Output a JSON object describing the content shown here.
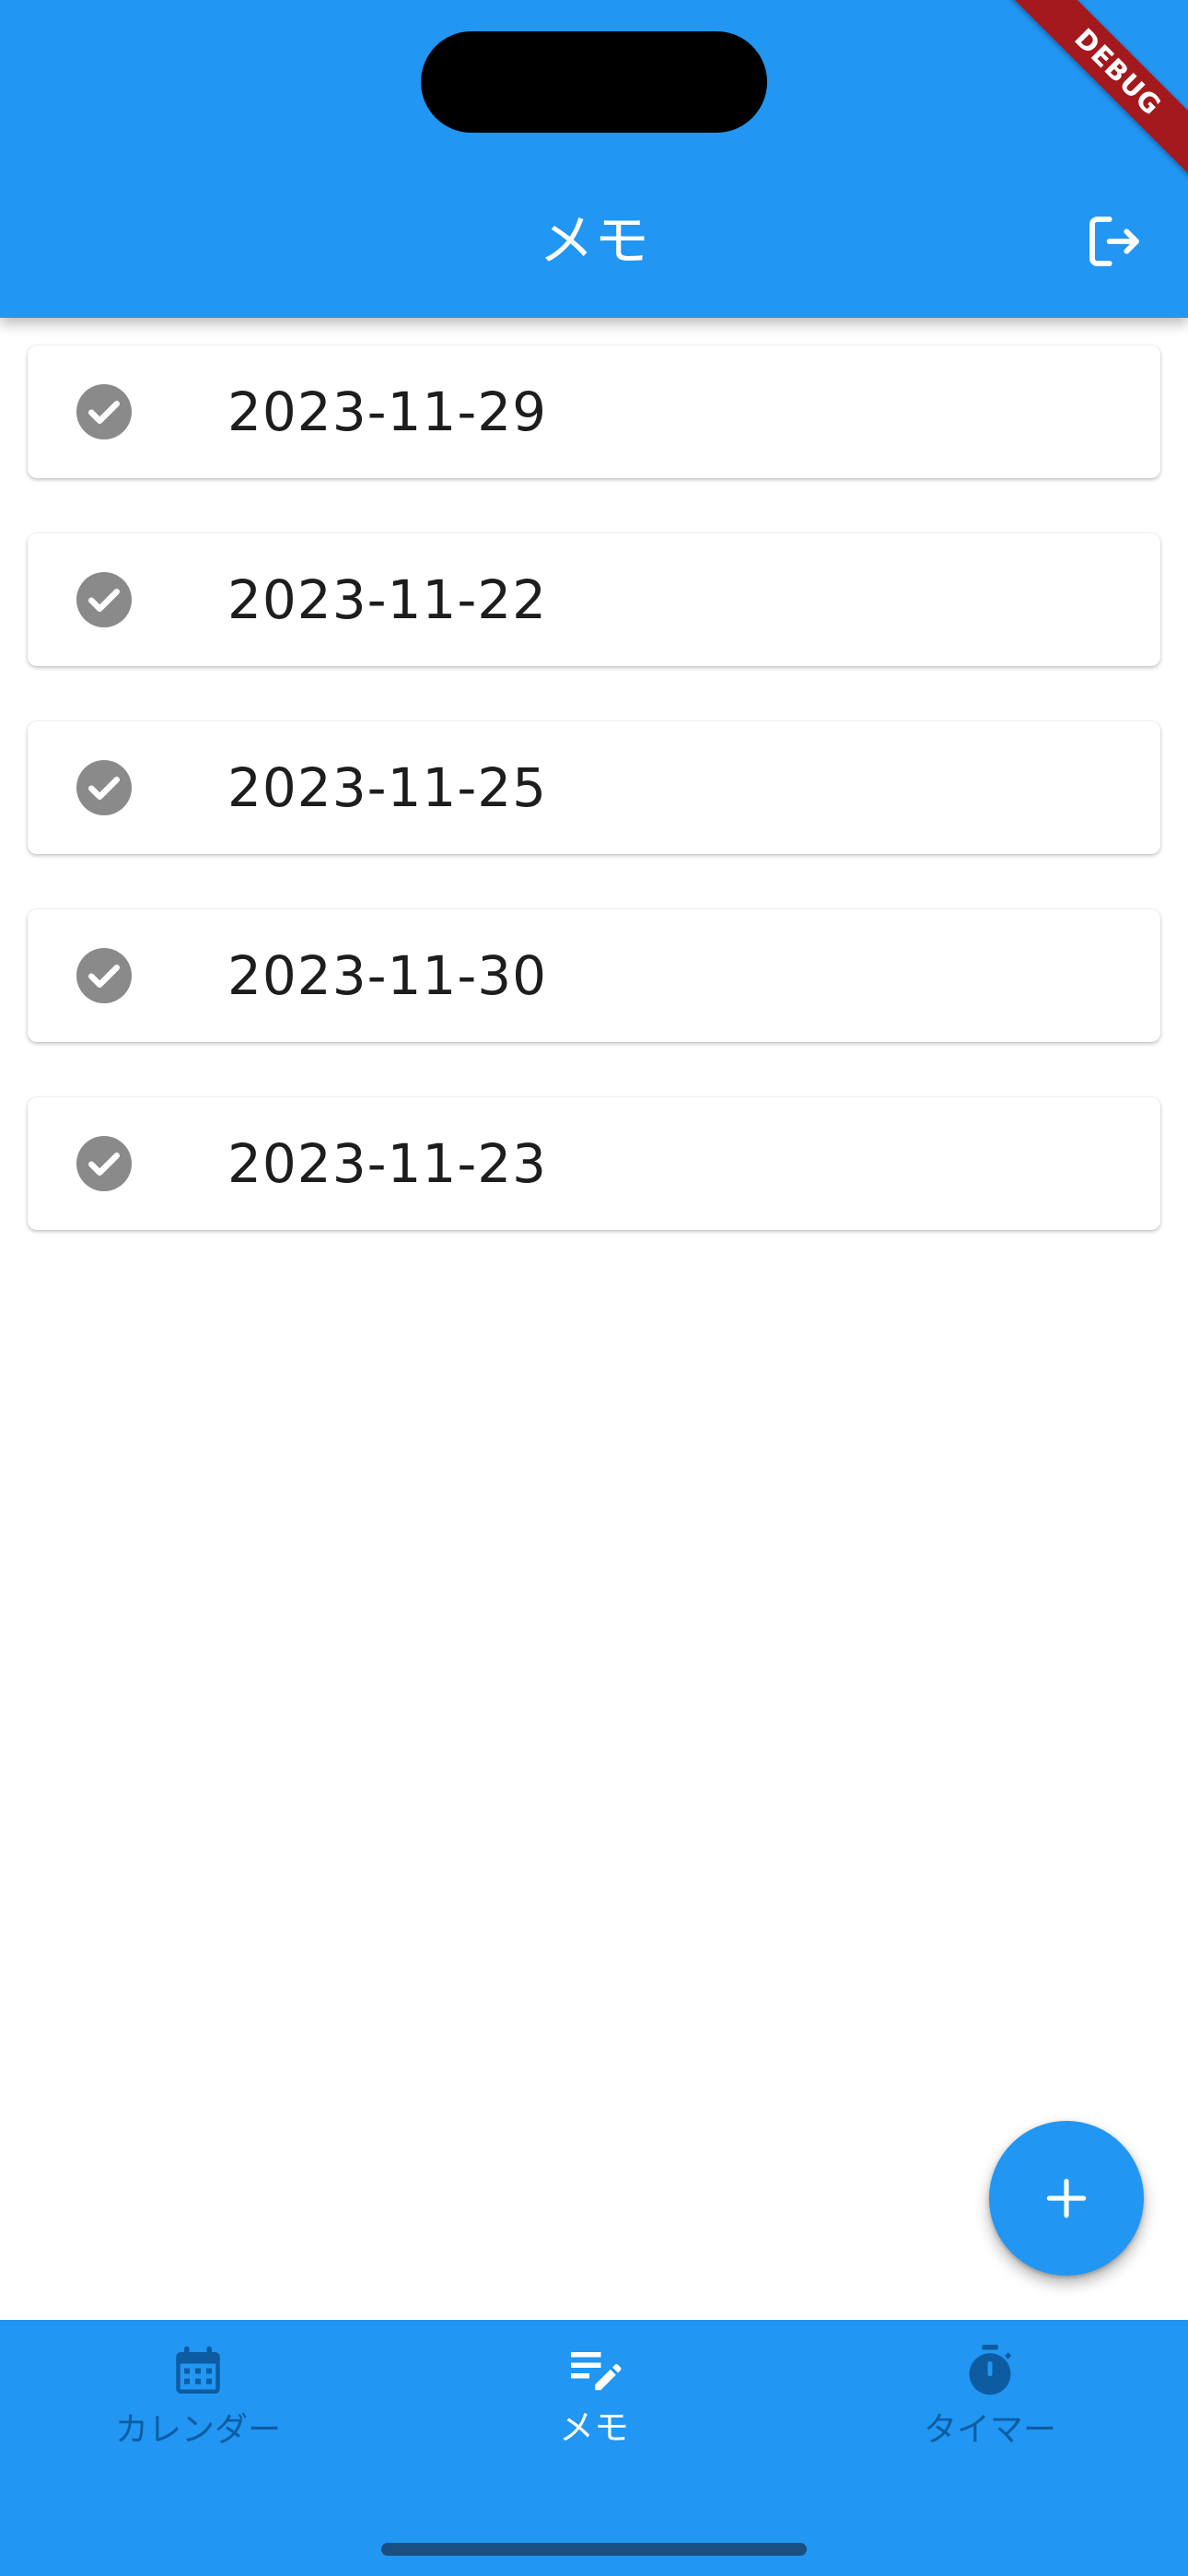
{
  "app_bar": {
    "title": "メモ",
    "logout_icon": "logout-icon",
    "background": "#2196F3"
  },
  "debug_banner": {
    "label": "DEBUG",
    "color": "#A4191E"
  },
  "memos": [
    {
      "date": "2023-11-29",
      "icon": "check-circle-icon"
    },
    {
      "date": "2023-11-22",
      "icon": "check-circle-icon"
    },
    {
      "date": "2023-11-25",
      "icon": "check-circle-icon"
    },
    {
      "date": "2023-11-30",
      "icon": "check-circle-icon"
    },
    {
      "date": "2023-11-23",
      "icon": "check-circle-icon"
    }
  ],
  "fab": {
    "icon": "plus-icon"
  },
  "bottom_nav": {
    "selected": "memo",
    "items": [
      {
        "key": "calendar",
        "label": "カレンダー",
        "icon": "calendar-icon"
      },
      {
        "key": "memo",
        "label": "メモ",
        "icon": "edit-note-icon"
      },
      {
        "key": "timer",
        "label": "タイマー",
        "icon": "timer-icon"
      }
    ]
  },
  "colors": {
    "primary": "#2196F3",
    "nav_inactive": "#0D5CA1",
    "check_icon": "#8a8a8a"
  }
}
